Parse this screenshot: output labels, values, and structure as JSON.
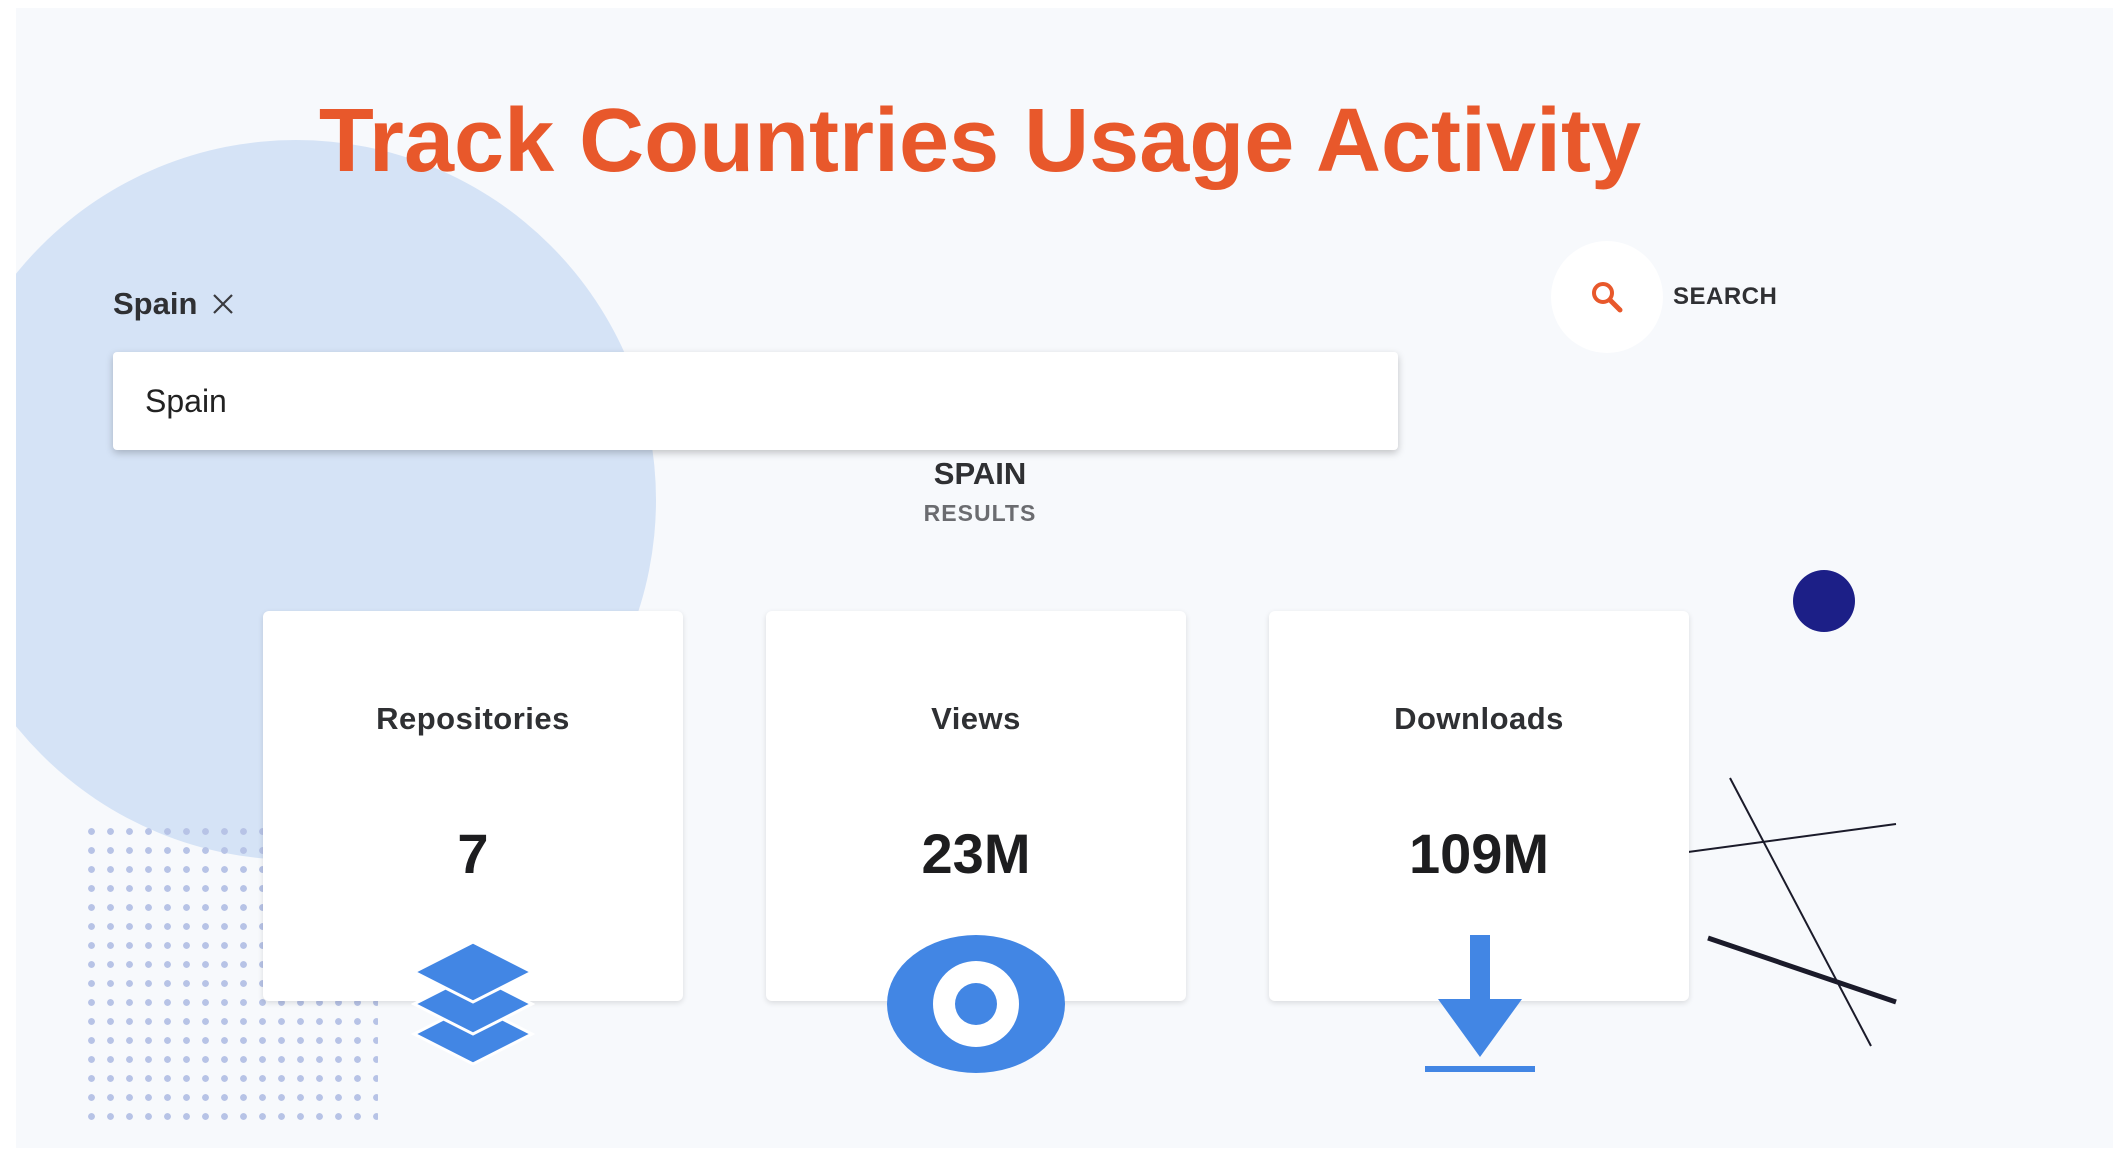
{
  "title": "Track Countries Usage Activity",
  "filter": {
    "chip_label": "Spain",
    "input_value": "Spain"
  },
  "search": {
    "button_label": "SEARCH",
    "icon": "search-icon"
  },
  "results": {
    "country": "SPAIN",
    "subtitle": "RESULTS"
  },
  "cards": [
    {
      "label": "Repositories",
      "value": "7",
      "icon": "layers-icon"
    },
    {
      "label": "Views",
      "value": "23M",
      "icon": "eye-icon"
    },
    {
      "label": "Downloads",
      "value": "109M",
      "icon": "download-icon"
    }
  ],
  "colors": {
    "title": "#e8582b",
    "accent_blue": "#4286e4",
    "search_icon": "#e8582b",
    "navy": "#1c1f87",
    "background": "#f7f9fc",
    "circle": "#d5e3f6"
  }
}
